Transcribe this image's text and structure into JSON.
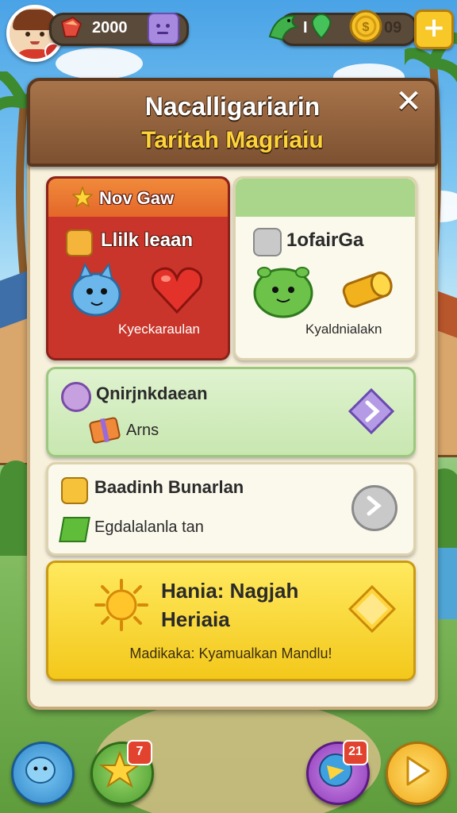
{
  "topbar": {
    "gems_value": "2000",
    "coins_prefix": "I",
    "coins_value": "09",
    "plus_label": "+"
  },
  "header": {
    "title": "Nacalligariarin",
    "subtitle": "Taritah Magriaiu",
    "close_label": "✕"
  },
  "card_left": {
    "head_label": "Nov Gaw",
    "title": "Llilk leaan",
    "caption": "Kyeckaraulan"
  },
  "card_right": {
    "title": "1ofairGa",
    "caption": "Kyaldnialakn"
  },
  "row1": {
    "title": "Qnirjnkdaean",
    "sub": "Arns"
  },
  "row2": {
    "title": "Baadinh Bunarlan",
    "sub": "Egdalalanla tan"
  },
  "row3": {
    "title_line1": "Hania: Nagjah",
    "title_line2": "Heriaia",
    "footer": "Madikaka: Kyamualkan Mandlu!"
  },
  "bottom_nav": {
    "badge_star": "7",
    "badge_chat": "21"
  },
  "icons": {
    "avatar": "player-avatar",
    "gem": "red-gem-icon",
    "emote": "purple-emote-icon",
    "dragon": "green-dragon-icon",
    "coin": "gold-coin-icon"
  },
  "colors": {
    "wood": "#8a5a36",
    "panel": "#f7f1dc",
    "title_yellow": "#ffd43a",
    "red_card": "#c9352a",
    "green_row": "#c8e7b0",
    "yellow_row": "#f3c81b"
  }
}
